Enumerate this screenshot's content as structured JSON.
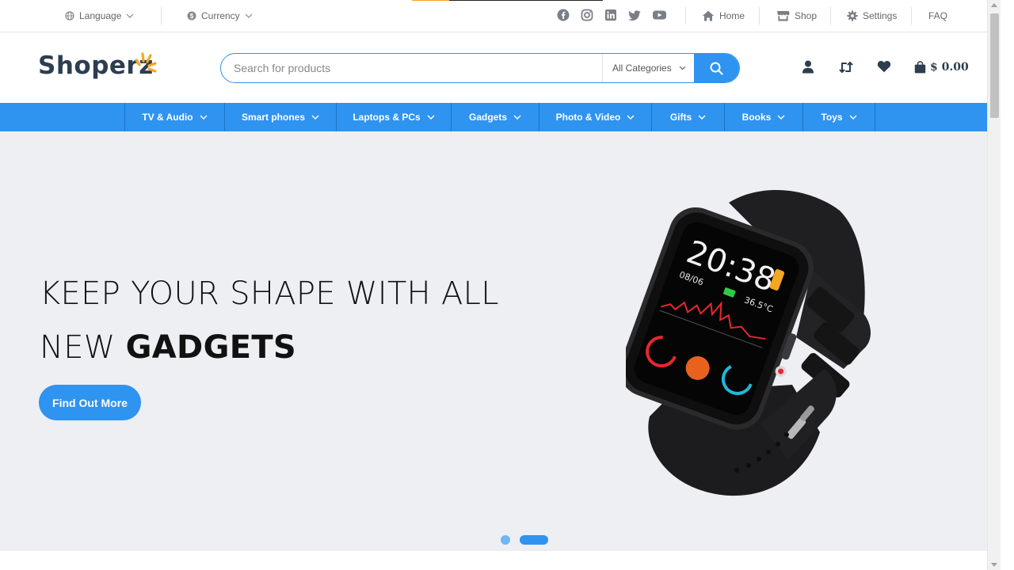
{
  "topbar": {
    "language_label": "Language",
    "currency_label": "Currency",
    "social_icons": [
      "facebook-icon",
      "instagram-icon",
      "linkedin-icon",
      "twitter-icon",
      "youtube-icon"
    ],
    "links": {
      "home": "Home",
      "shop": "Shop",
      "settings": "Settings",
      "faq": "FAQ"
    }
  },
  "header": {
    "logo_text": "Shoperz",
    "search": {
      "placeholder": "Search for products",
      "value": "",
      "category": "All Categories"
    },
    "cart_total": "$ 0.00"
  },
  "nav": {
    "items": [
      {
        "label": "TV & Audio"
      },
      {
        "label": "Smart phones"
      },
      {
        "label": "Laptops & PCs"
      },
      {
        "label": "Gadgets"
      },
      {
        "label": "Photo & Video"
      },
      {
        "label": "Gifts"
      },
      {
        "label": "Books"
      },
      {
        "label": "Toys"
      }
    ]
  },
  "hero": {
    "title_line1": "KEEP YOUR SHAPE WITH ALL",
    "title_line2_prefix": "NEW ",
    "title_line2_bold": "GADGETS",
    "button_label": "Find Out More",
    "watch_screen": {
      "time": "20:38",
      "date": "08/06",
      "temp": "36.5°C"
    },
    "slide_count": 2,
    "active_slide": 2
  },
  "colors": {
    "accent": "#2f93f0",
    "hero_bg": "#eeeff3",
    "logo_dark": "#2c3e50",
    "logo_sun": "#f5a623"
  }
}
